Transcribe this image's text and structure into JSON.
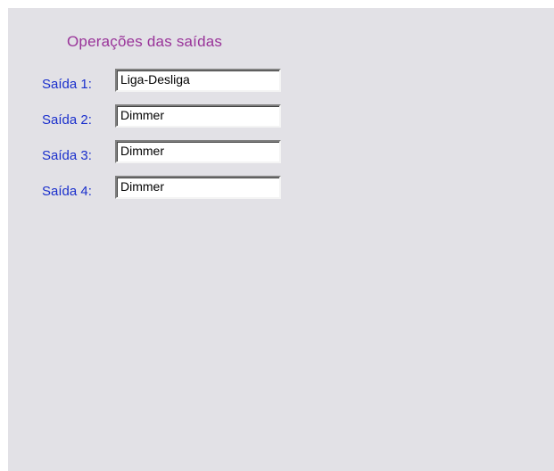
{
  "panel": {
    "title": "Operações das saídas",
    "outputs": [
      {
        "label": "Saída 1:",
        "value": "Liga-Desliga"
      },
      {
        "label": "Saída 2:",
        "value": "Dimmer"
      },
      {
        "label": "Saída 3:",
        "value": "Dimmer"
      },
      {
        "label": "Saída 4:",
        "value": "Dimmer"
      }
    ]
  },
  "colors": {
    "panel_background": "#e2e1e6",
    "title_text": "#993399",
    "label_text": "#1a2fcc"
  }
}
